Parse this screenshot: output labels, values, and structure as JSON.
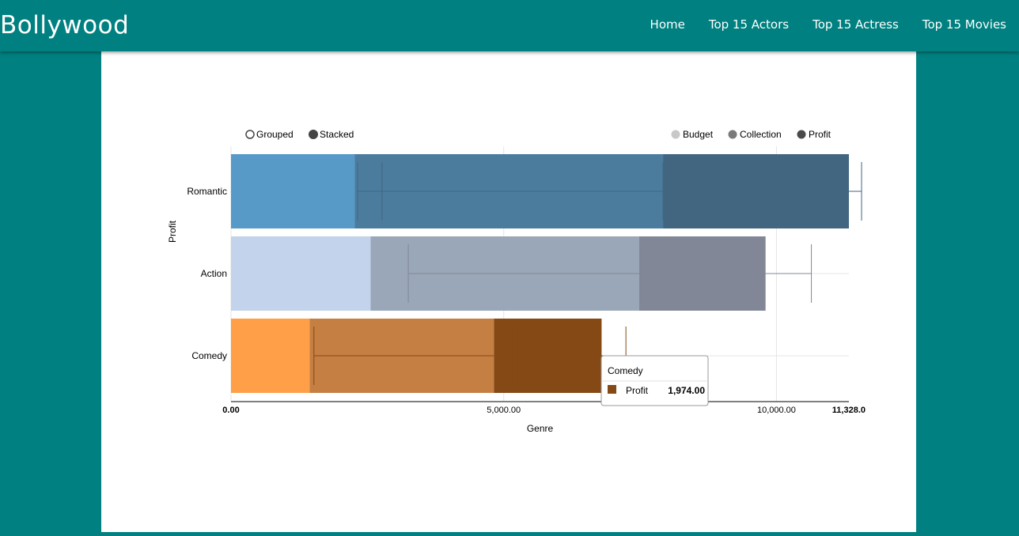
{
  "nav": {
    "brand": "Bollywood",
    "links": [
      "Home",
      "Top 15 Actors",
      "Top 15 Actress",
      "Top 15 Movies"
    ]
  },
  "controls": {
    "grouped_label": "Grouped",
    "stacked_label": "Stacked",
    "selected": "Stacked"
  },
  "chart_data": {
    "type": "bar",
    "orientation": "horizontal",
    "stacked": true,
    "categories": [
      "Romantic",
      "Action",
      "Comedy"
    ],
    "series": [
      {
        "name": "Budget",
        "values": [
          2270,
          2560,
          1440
        ]
      },
      {
        "name": "Collection",
        "values": [
          5650,
          4920,
          3380
        ]
      },
      {
        "name": "Profit",
        "values": [
          3408,
          2320,
          1974
        ]
      }
    ],
    "error_bars": [
      {
        "category": "Romantic",
        "marks": [
          2320,
          2770,
          7920,
          8930,
          11560
        ]
      },
      {
        "category": "Action",
        "marks": [
          3250,
          7520,
          10640
        ]
      },
      {
        "category": "Comedy",
        "marks": [
          1520,
          5270,
          7240
        ]
      }
    ],
    "xlabel": "Genre",
    "ylabel": "Profit",
    "x_ticks": [
      "0.00",
      "5,000.00",
      "10,000.00",
      "11,328.0"
    ],
    "x_tick_values": [
      0,
      5000,
      10000,
      11328
    ],
    "xlim": [
      0,
      11328
    ],
    "legend": {
      "position": "top-right",
      "entries": [
        "Budget",
        "Collection",
        "Profit"
      ]
    },
    "grid": true,
    "colors": {
      "Romantic": [
        "#5799c7",
        "#4b7c9e",
        "#426680"
      ],
      "Action": [
        "#c2d3eb",
        "#9aa7b8",
        "#818797"
      ],
      "Comedy": [
        "#ff9f48",
        "#c57f43",
        "#844915"
      ]
    },
    "legend_colors": [
      "#c8c8c8",
      "#7a7a7a",
      "#4a4a4a"
    ],
    "tooltip": {
      "title": "Comedy",
      "series": "Profit",
      "value": "1,974.00",
      "swatch": "#844915"
    }
  }
}
